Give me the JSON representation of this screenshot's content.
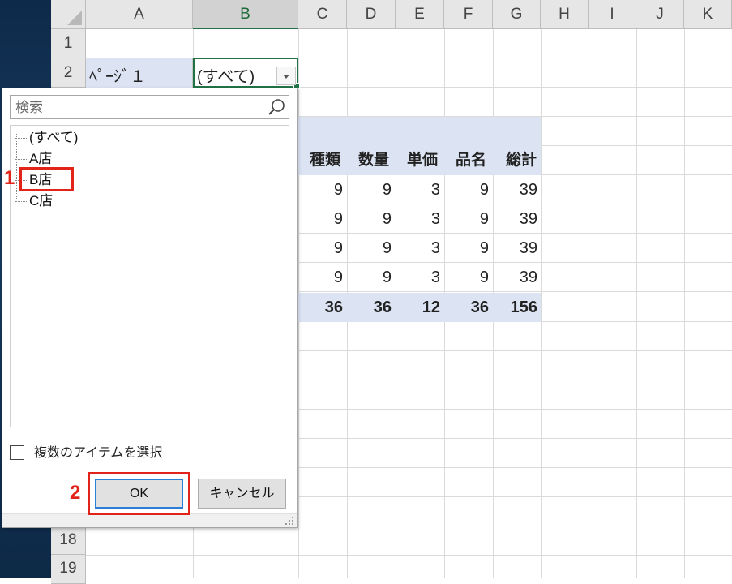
{
  "columns": [
    "A",
    "B",
    "C",
    "D",
    "E",
    "F",
    "G",
    "H",
    "I",
    "J",
    "K"
  ],
  "rows": [
    "1",
    "2",
    "18",
    "19"
  ],
  "page_field": {
    "label": "ﾍﾟｰｼﾞ１",
    "value": "(すべて)"
  },
  "pivot": {
    "headers": [
      "種類",
      "数量",
      "単価",
      "品名",
      "総計"
    ],
    "rows": [
      [
        "9",
        "9",
        "3",
        "9",
        "39"
      ],
      [
        "9",
        "9",
        "3",
        "9",
        "39"
      ],
      [
        "9",
        "9",
        "3",
        "9",
        "39"
      ],
      [
        "9",
        "9",
        "3",
        "9",
        "39"
      ]
    ],
    "totals": [
      "36",
      "36",
      "12",
      "36",
      "156"
    ]
  },
  "filter_dialog": {
    "search_placeholder": "検索",
    "items": [
      "(すべて)",
      "A店",
      "B店",
      "C店"
    ],
    "multi_select_label": "複数のアイテムを選択",
    "ok_label": "OK",
    "cancel_label": "キャンセル"
  },
  "annotations": [
    "1",
    "2"
  ],
  "colors": {
    "accent_red": "#e2231a",
    "selection_green": "#217346",
    "pivot_band": "#dce3f3",
    "ok_focus": "#2b7fd6"
  }
}
